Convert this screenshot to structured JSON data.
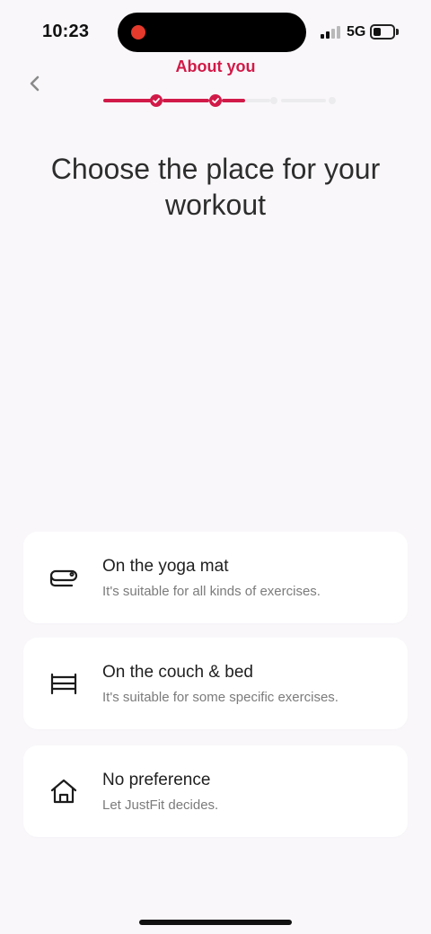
{
  "status_bar": {
    "time": "10:23",
    "network": "5G",
    "recording_color": "#e53a2c"
  },
  "header": {
    "title": "About you",
    "back_icon": "chevron-left-icon",
    "progress": {
      "total_steps": 4,
      "completed_steps": 2,
      "accent": "#d11a48"
    }
  },
  "main": {
    "title": "Choose the place for your workout",
    "options": [
      {
        "title": "On the yoga mat",
        "description": "It's suitable for all kinds of exercises.",
        "icon": "yoga-mat-icon"
      },
      {
        "title": "On the couch & bed",
        "description": "It's suitable for some specific exercises.",
        "icon": "bed-icon"
      },
      {
        "title": "No preference",
        "description": "Let JustFit decides.",
        "icon": "home-icon"
      }
    ]
  }
}
